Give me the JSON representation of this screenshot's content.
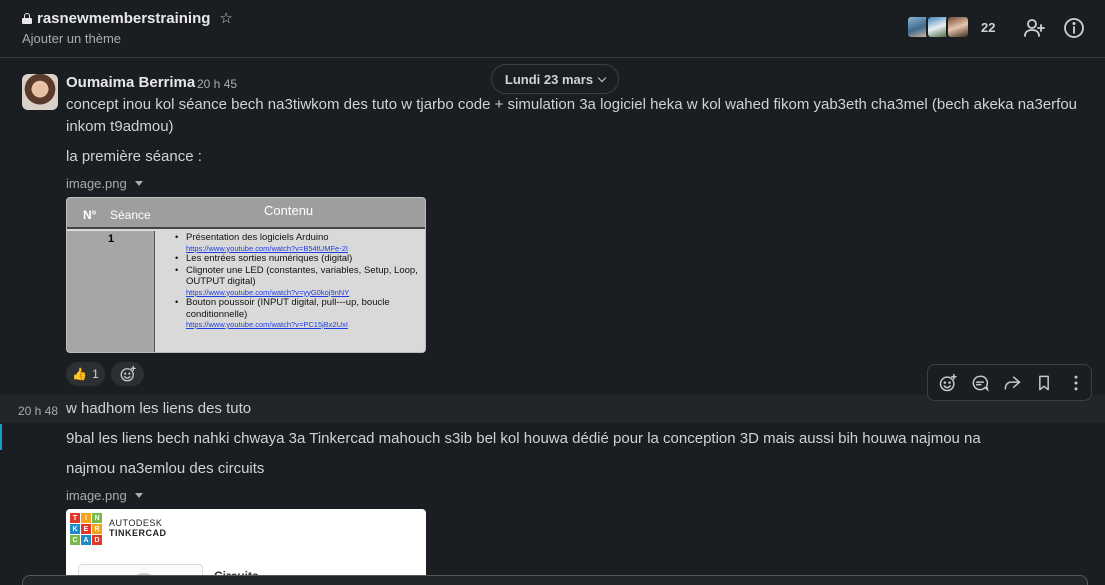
{
  "channel": {
    "name": "rasnewmemberstraining",
    "topic": "Ajouter un thème",
    "member_count": "22"
  },
  "date_divider": "Lundi 23 mars",
  "message1": {
    "author": "Oumaima Berrima",
    "time": "20 h 45",
    "text1": "concept inou kol séance bech na3tiwkom des tuto w tjarbo code + simulation 3a logiciel heka w kol wahed fikom yab3eth cha3mel (bech akeka na3erfou inkom t9admou)",
    "text2": "la première séance :",
    "file_name": "image.png",
    "table": {
      "col_no": "N°",
      "col_seance": "Séance",
      "col_contenu": "Contenu",
      "row_num": "1",
      "items": [
        {
          "text": "Présentation des logiciels Arduino",
          "link": "https://www.youtube.com/watch?v=B54tUMFe-2I"
        },
        {
          "text": "Les entrées sorties numériques (digital)",
          "link": ""
        },
        {
          "text": "Clignoter une LED (constantes, variables, Setup, Loop, OUTPUT digital)",
          "link": "https://www.youtube.com/watch?v=yyG0koj9nNY"
        },
        {
          "text": "Bouton poussoir (INPUT digital, pull---up, boucle conditionnelle)",
          "link": "https://www.youtube.com/watch?v=PC15jBx2UxI"
        }
      ]
    },
    "reaction": {
      "emoji": "👍",
      "count": "1"
    }
  },
  "message2": {
    "time": "20 h 48",
    "text1": "w hadhom les liens des tuto",
    "text2": "9bal les liens bech nahki chwaya 3a Tinkercad mahouch s3ib bel kol houwa dédié pour la conception 3D mais aussi bih houwa najmou na",
    "text3": "najmou na3emlou des circuits",
    "file_name": "image.png",
    "tinkercad": {
      "logo_letters": [
        "TIN",
        "KER",
        "CAD"
      ],
      "brand_line1": "AUTODESK",
      "brand_line2": "TINKERCAD",
      "section": "Circuits"
    }
  },
  "colors": {
    "background": "#1a1d21",
    "accent_blue": "#1d9bd1",
    "text": "#d1d2d3",
    "muted": "#ababad"
  }
}
